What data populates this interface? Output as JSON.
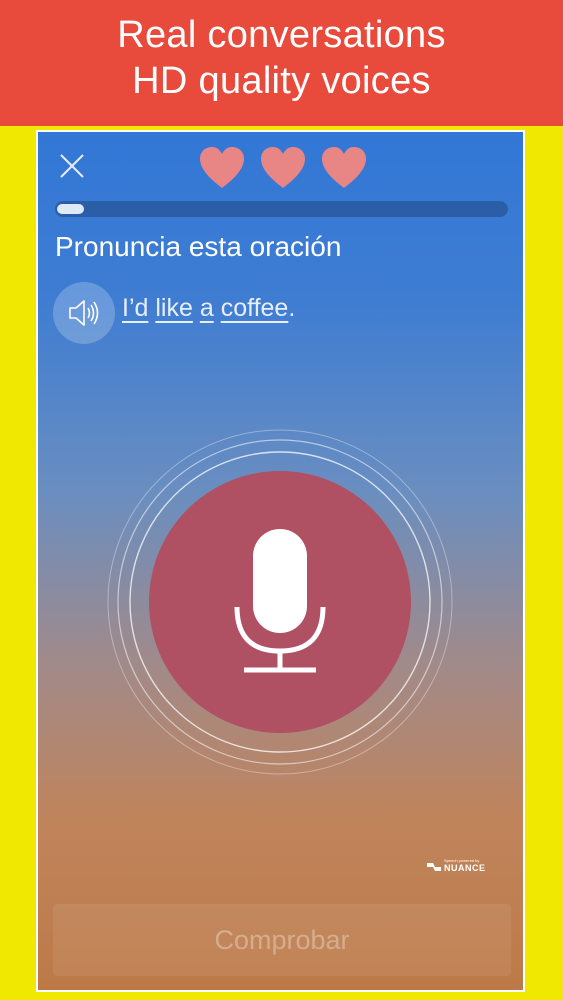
{
  "banner": {
    "line1": "Real conversations",
    "line2": "HD quality voices"
  },
  "header": {
    "close_icon": "close-icon",
    "hearts": [
      "heart-icon",
      "heart-icon",
      "heart-icon"
    ],
    "hearts_count": 3,
    "progress_fraction": 0.06
  },
  "exercise": {
    "instruction": "Pronuncia esta oración",
    "speaker_icon": "speaker-icon",
    "sentence": {
      "w1": "I’d",
      "w2": "like",
      "w3": "a",
      "w4": "coffee",
      "end": "."
    }
  },
  "mic": {
    "icon": "microphone-icon"
  },
  "attribution": {
    "small": "Speech powered by",
    "name": "NUANCE"
  },
  "footer": {
    "check_label": "Comprobar"
  },
  "colors": {
    "banner": "#e84a3c",
    "background": "#f0e800",
    "heart": "#e88585",
    "mic_button": "#b05063",
    "gradient_top": "#3277d6",
    "gradient_bottom": "#bd7a48"
  }
}
